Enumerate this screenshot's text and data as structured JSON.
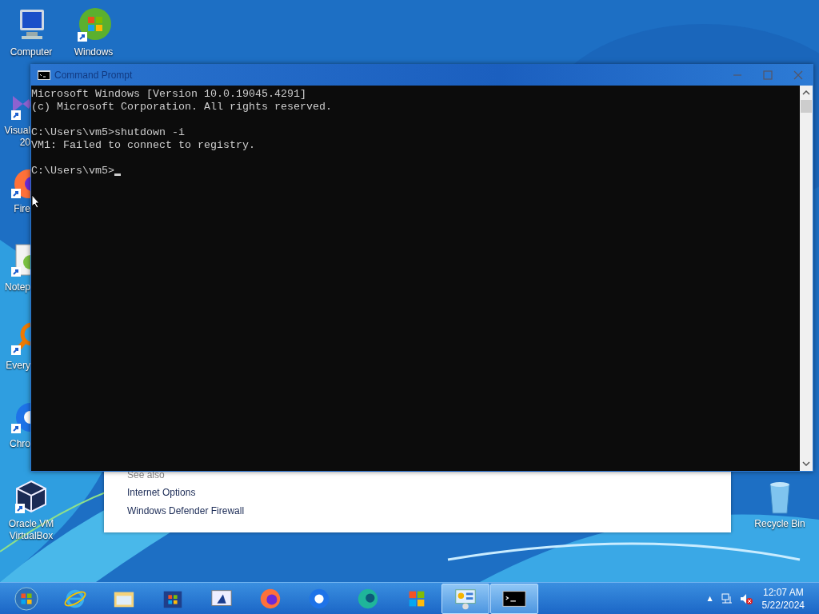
{
  "desktop": {
    "icons": [
      {
        "kind": "computer",
        "label": "Computer"
      },
      {
        "kind": "media",
        "label": "Windows"
      },
      {
        "kind": "studio",
        "label": "Visual",
        "label_2": "20"
      },
      {
        "kind": "firefox",
        "label": "Fire"
      },
      {
        "kind": "notepad",
        "label": "Notep"
      },
      {
        "kind": "everything",
        "label": "Every"
      },
      {
        "kind": "chrome",
        "label": "Chro"
      },
      {
        "kind": "virtualbox",
        "label": "Oracle VM",
        "label_2": "VirtualBox"
      },
      {
        "kind": "recycle",
        "label": "Recycle Bin"
      }
    ]
  },
  "background_window": {
    "heading": "See also",
    "links": [
      "Internet Options",
      "Windows Defender Firewall"
    ]
  },
  "console_window": {
    "title": "Command Prompt",
    "blocks": [
      [
        "Microsoft Windows [Version 10.0.19045.4291]",
        "(c) Microsoft Corporation. All rights reserved."
      ],
      [
        "C:\\Users\\vm5>shutdown -i",
        "VM1: Failed to connect to registry."
      ],
      [
        "C:\\Users\\vm5>"
      ]
    ]
  },
  "taskbar": {
    "apps": [
      {
        "kind": "start",
        "active": false
      },
      {
        "kind": "ie",
        "active": false
      },
      {
        "kind": "explorer",
        "active": false
      },
      {
        "kind": "store",
        "active": false
      },
      {
        "kind": "screen",
        "active": false
      },
      {
        "kind": "firefox",
        "active": false
      },
      {
        "kind": "chrome",
        "active": false
      },
      {
        "kind": "edge",
        "active": false
      },
      {
        "kind": "media",
        "active": false
      },
      {
        "kind": "control",
        "active": true
      },
      {
        "kind": "console",
        "active": true
      }
    ],
    "tray": {
      "overflow": "▲",
      "time": "12:07 AM",
      "date": "5/22/2024"
    }
  }
}
